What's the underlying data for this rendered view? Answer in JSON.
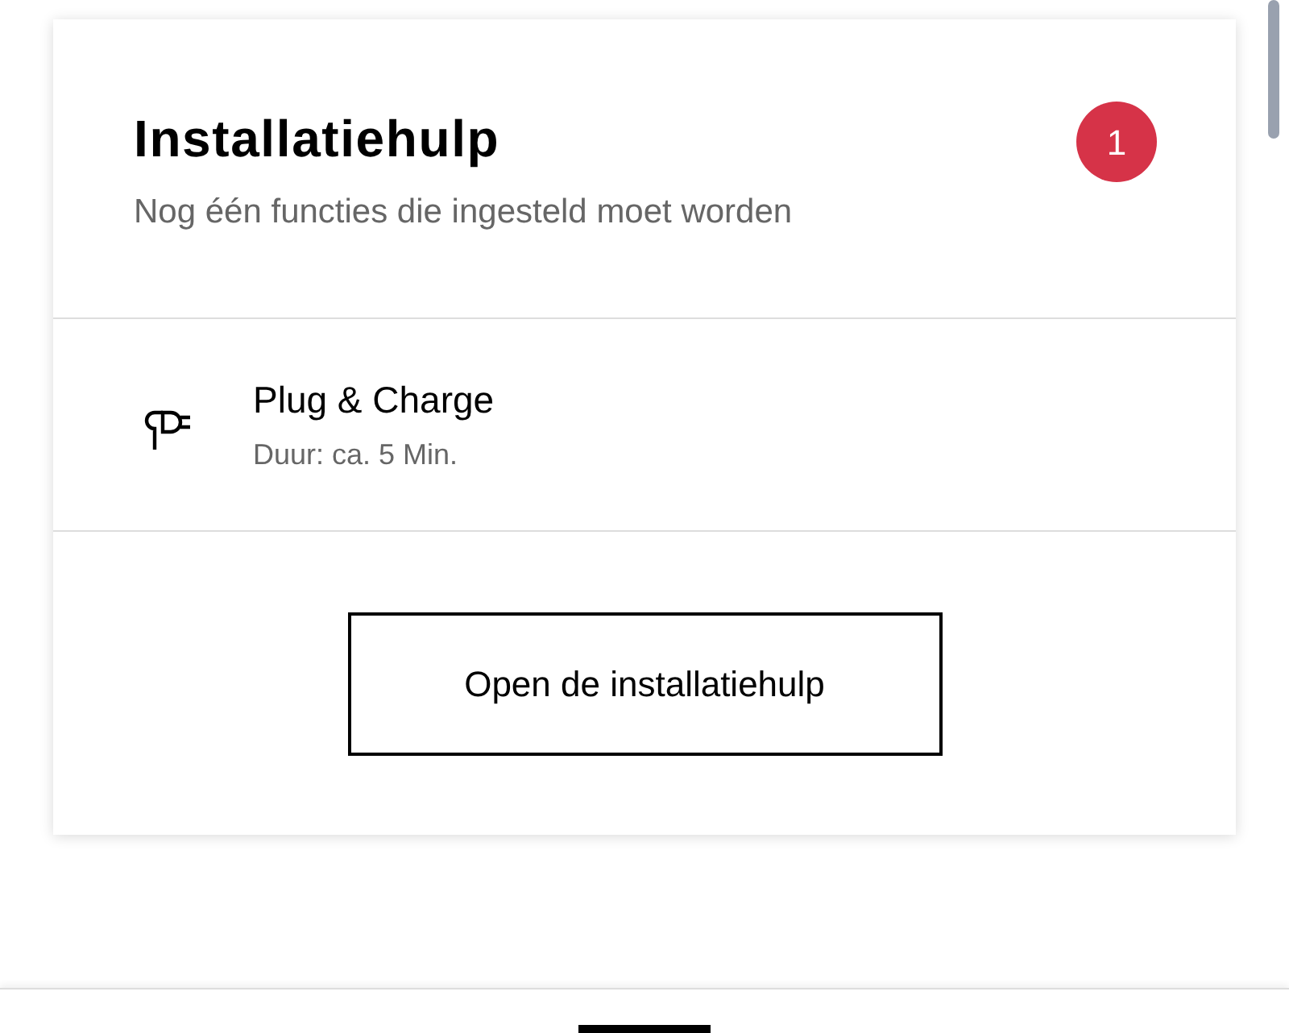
{
  "card": {
    "title": "Installatiehulp",
    "subtitle": "Nog één functies die ingesteld moet worden",
    "badge": "1",
    "items": [
      {
        "title": "Plug & Charge",
        "duration": "Duur: ca. 5 Min."
      }
    ],
    "button": "Open de installatiehulp"
  }
}
